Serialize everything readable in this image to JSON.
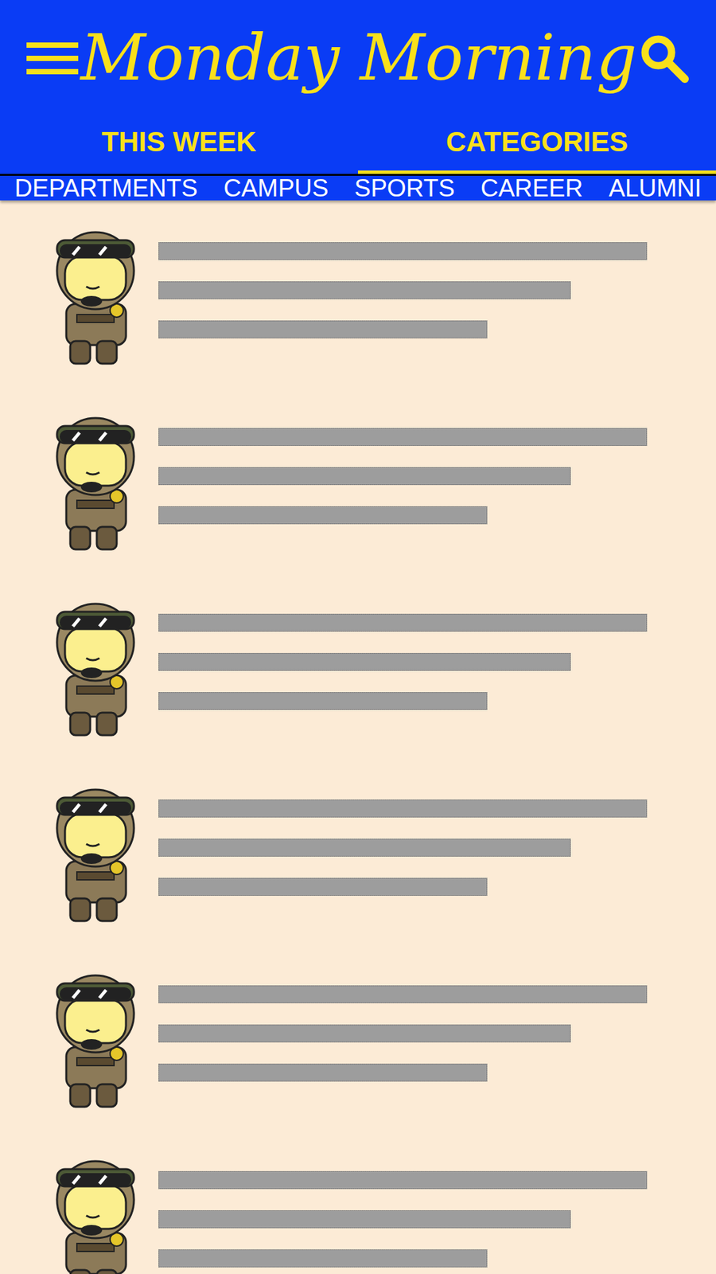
{
  "header": {
    "title": "Monday Morning"
  },
  "tabs": [
    {
      "label": "THIS WEEK",
      "selected": false
    },
    {
      "label": "CATEGORIES",
      "selected": true
    }
  ],
  "categories": [
    "DEPARTMENTS",
    "CAMPUS",
    "SPORTS",
    "CAREER",
    "ALUMNI"
  ],
  "articles": [
    {
      "placeholder_lines": 3
    },
    {
      "placeholder_lines": 3
    },
    {
      "placeholder_lines": 3
    },
    {
      "placeholder_lines": 3
    },
    {
      "placeholder_lines": 3
    },
    {
      "placeholder_lines": 3
    }
  ]
}
